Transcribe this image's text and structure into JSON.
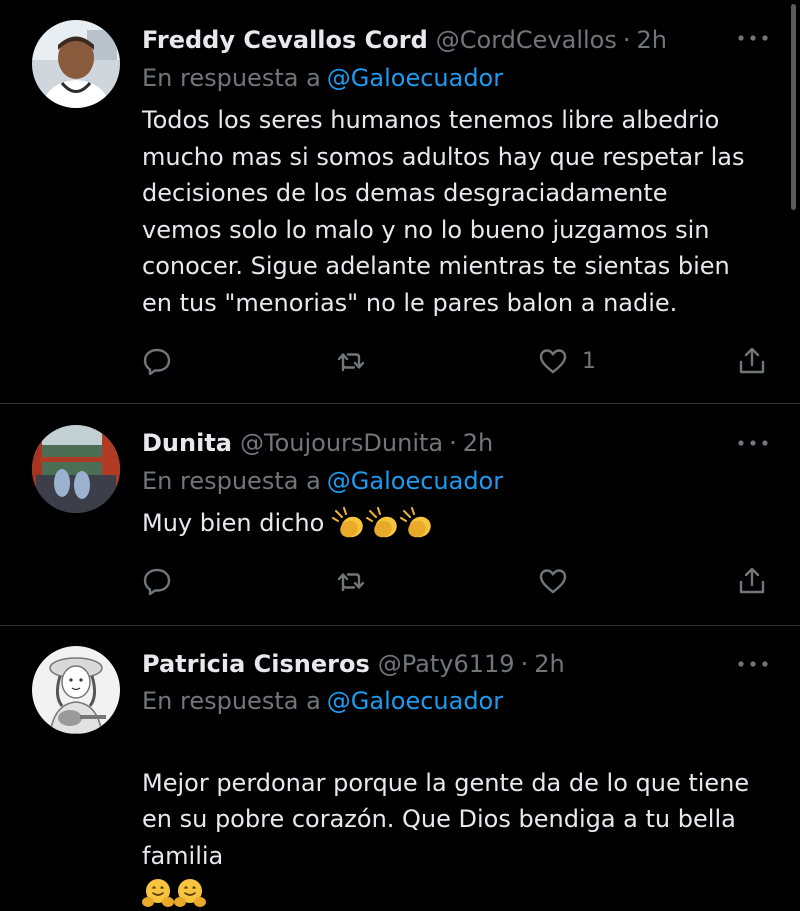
{
  "tweets": [
    {
      "name": "Freddy Cevallos Cord",
      "handle": "@CordCevallos",
      "time": "2h",
      "reply_prefix": "En respuesta a",
      "reply_mention": "@Galoecuador",
      "text": "Todos los seres humanos tenemos libre albedrio\nmucho mas si somos adultos hay que respetar las\ndecisiones de los demas desgraciadamente\nvemos solo lo malo y no lo bueno juzgamos sin\nconocer. Sigue adelante mientras te sientas bien\nen tus \"menorias\" no le pares balon a nadie.",
      "like_count": "1"
    },
    {
      "name": "Dunita",
      "handle": "@ToujoursDunita",
      "time": "2h",
      "reply_prefix": "En respuesta a",
      "reply_mention": "@Galoecuador",
      "text": "Muy bien dicho",
      "emoji": [
        "clapping-hands",
        "clapping-hands",
        "clapping-hands"
      ]
    },
    {
      "name": "Patricia Cisneros",
      "handle": "@Paty6119",
      "time": "2h",
      "reply_prefix": "En respuesta a",
      "reply_mention": "@Galoecuador",
      "text": "Mejor perdonar porque la gente da de lo que tiene\nen su pobre corazón. Que Dios bendiga a tu bella\nfamilia",
      "emoji": [
        "hugging-face",
        "hugging-face"
      ]
    }
  ],
  "colors": {
    "background": "#000000",
    "text": "#e7e9ea",
    "muted": "#71767b",
    "link": "#1d9bf0",
    "divider": "#2f3336"
  }
}
